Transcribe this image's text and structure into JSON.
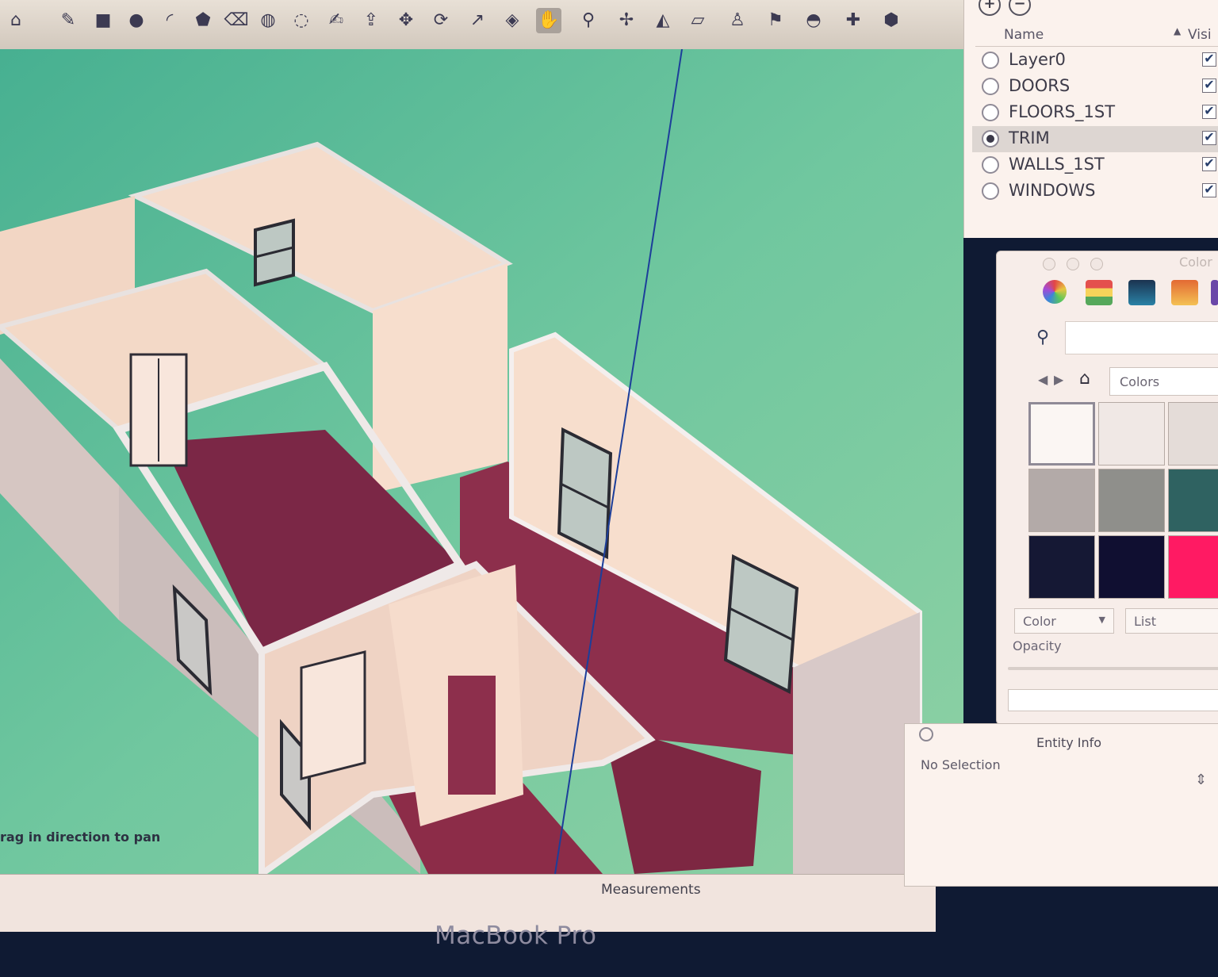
{
  "toolbar": {
    "tools": [
      {
        "name": "home-icon",
        "glyph": "⌂"
      },
      {
        "name": "pencil-icon",
        "glyph": "✎"
      },
      {
        "name": "rectangle-icon",
        "glyph": "■"
      },
      {
        "name": "circle-icon",
        "glyph": "●"
      },
      {
        "name": "arc-icon",
        "glyph": "◜"
      },
      {
        "name": "polygon-icon",
        "glyph": "⬟"
      },
      {
        "name": "eraser-icon",
        "glyph": "⌫"
      },
      {
        "name": "paint-bucket-icon",
        "glyph": "◍"
      },
      {
        "name": "tape-measure-icon",
        "glyph": "◌"
      },
      {
        "name": "text-icon",
        "glyph": "✍"
      },
      {
        "name": "push-pull-icon",
        "glyph": "⇪"
      },
      {
        "name": "move-icon",
        "glyph": "✥"
      },
      {
        "name": "rotate-icon",
        "glyph": "⟳"
      },
      {
        "name": "follow-me-icon",
        "glyph": "↗"
      },
      {
        "name": "orbit-icon",
        "glyph": "◈"
      },
      {
        "name": "pan-hand-icon",
        "glyph": "✋"
      },
      {
        "name": "zoom-icon",
        "glyph": "⚲"
      },
      {
        "name": "zoom-extents-icon",
        "glyph": "✢"
      },
      {
        "name": "protractor-icon",
        "glyph": "◭"
      },
      {
        "name": "section-plane-icon",
        "glyph": "▱"
      },
      {
        "name": "walk-icon",
        "glyph": "♙"
      },
      {
        "name": "position-camera-icon",
        "glyph": "⚑"
      },
      {
        "name": "sandbox-icon",
        "glyph": "◓"
      },
      {
        "name": "component-icon",
        "glyph": "✚"
      },
      {
        "name": "warehouse-icon",
        "glyph": "⬢"
      }
    ],
    "active_tool": "pan-hand-icon"
  },
  "viewport": {
    "status_hint": "rag in direction to pan",
    "measurements_label": "Measurements"
  },
  "bezel": {
    "logo": "MacBook Pro"
  },
  "layers": {
    "add_glyph": "+",
    "remove_glyph": "−",
    "header_name": "Name",
    "header_sort": "▲",
    "header_visible": "Visi",
    "rows": [
      {
        "name": "Layer0",
        "active": false,
        "visible": true
      },
      {
        "name": "DOORS",
        "active": false,
        "visible": true
      },
      {
        "name": "FLOORS_1ST",
        "active": false,
        "visible": true
      },
      {
        "name": "TRIM",
        "active": true,
        "visible": true
      },
      {
        "name": "WALLS_1ST",
        "active": false,
        "visible": true
      },
      {
        "name": "WINDOWS",
        "active": false,
        "visible": true
      }
    ]
  },
  "colors_panel": {
    "title": "Color",
    "search_glyph": "⚲",
    "back_glyph": "◀",
    "forward_glyph": "▶",
    "home_glyph": "⌂",
    "collection": "Colors",
    "swatches": [
      "#fbf6f3",
      "#f0e8e5",
      "#e4dcd8",
      "#b3aaa8",
      "#8f8f8b",
      "#2f6261",
      "#151834",
      "#100f31",
      "#ff1a63"
    ],
    "color_select": "Color",
    "view_select": "List",
    "opacity_label": "Opacity"
  },
  "entity_info": {
    "title": "Entity Info",
    "status": "No Selection",
    "expand_glyph": "⇕"
  },
  "colors": {
    "viewport_bg": "#64c39c",
    "floor": "#7b2746",
    "wall": "#f7decd",
    "wall_shade": "#d6c6c2"
  }
}
